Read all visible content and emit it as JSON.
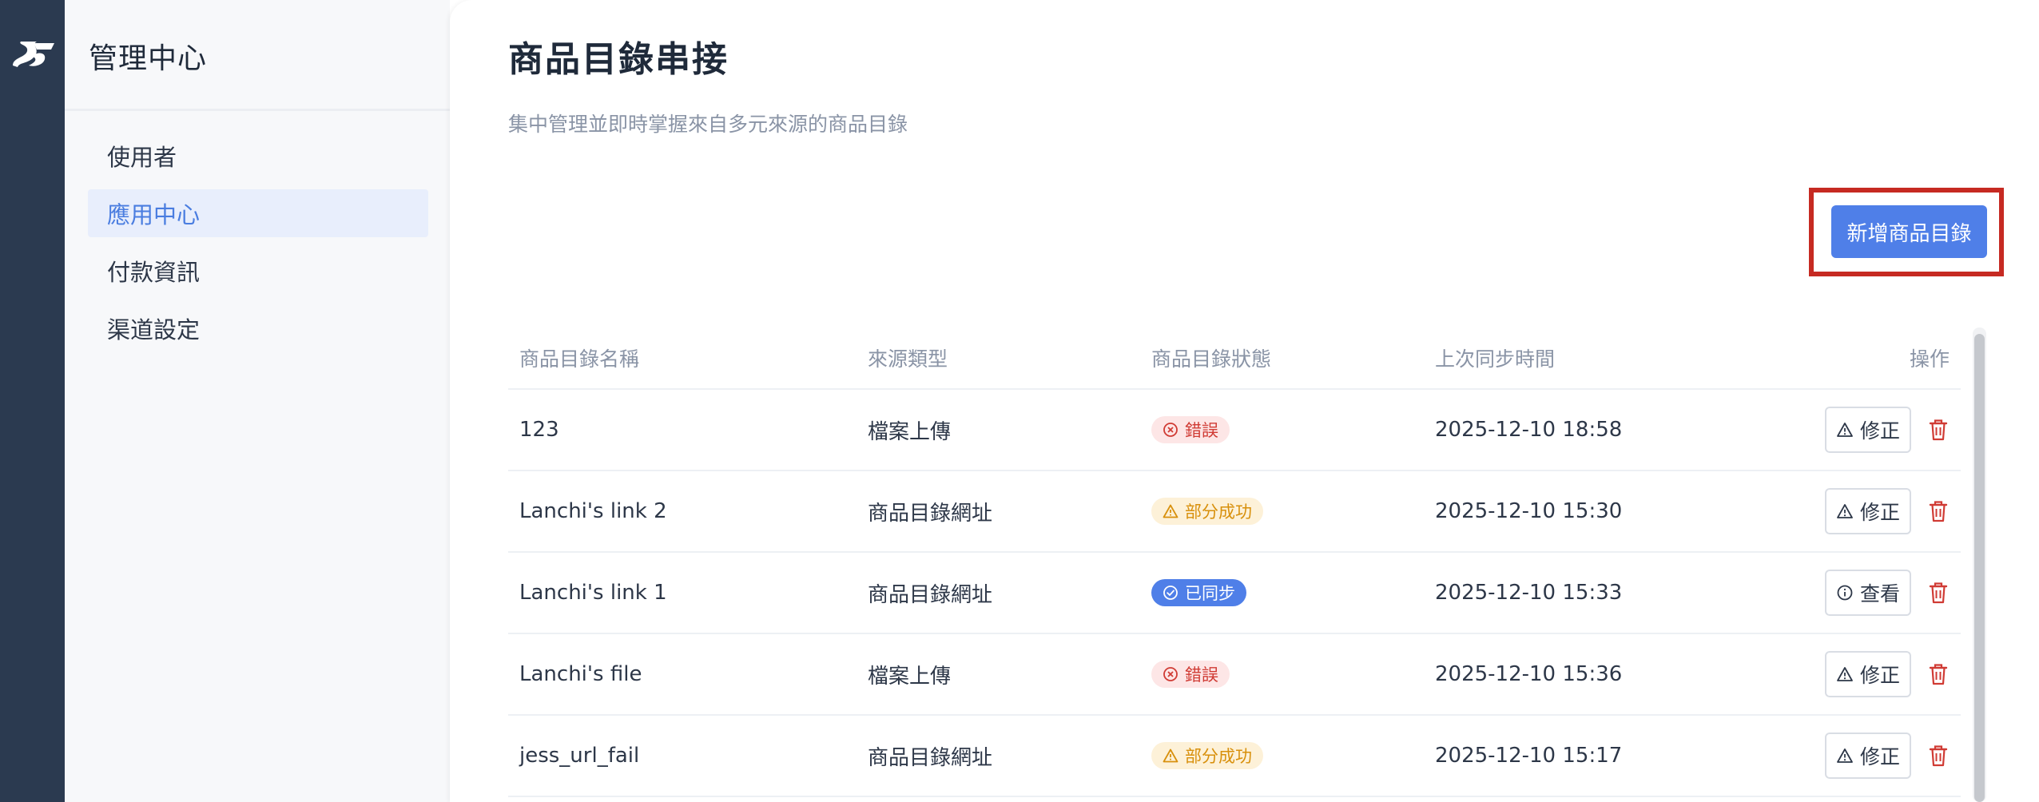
{
  "sidebar": {
    "title": "管理中心",
    "items": [
      {
        "label": "使用者",
        "active": false
      },
      {
        "label": "應用中心",
        "active": true
      },
      {
        "label": "付款資訊",
        "active": false
      },
      {
        "label": "渠道設定",
        "active": false
      }
    ]
  },
  "page": {
    "title": "商品目錄串接",
    "subtitle": "集中管理並即時掌握來自多元來源的商品目錄",
    "add_button": "新增商品目錄"
  },
  "table": {
    "headers": {
      "name": "商品目錄名稱",
      "source": "來源類型",
      "status": "商品目錄狀態",
      "time": "上次同步時間",
      "actions": "操作"
    },
    "rows": [
      {
        "name": "123",
        "source": "檔案上傳",
        "status": "錯誤",
        "status_type": "error",
        "time": "2025-12-10 18:58",
        "action": "修正",
        "action_icon": "warning-icon"
      },
      {
        "name": "Lanchi's link 2",
        "source": "商品目錄網址",
        "status": "部分成功",
        "status_type": "partial",
        "time": "2025-12-10 15:30",
        "action": "修正",
        "action_icon": "warning-icon"
      },
      {
        "name": "Lanchi's link 1",
        "source": "商品目錄網址",
        "status": "已同步",
        "status_type": "synced",
        "time": "2025-12-10 15:33",
        "action": "查看",
        "action_icon": "info-icon"
      },
      {
        "name": "Lanchi's file",
        "source": "檔案上傳",
        "status": "錯誤",
        "status_type": "error",
        "time": "2025-12-10 15:36",
        "action": "修正",
        "action_icon": "warning-icon"
      },
      {
        "name": "jess_url_fail",
        "source": "商品目錄網址",
        "status": "部分成功",
        "status_type": "partial",
        "time": "2025-12-10 15:17",
        "action": "修正",
        "action_icon": "warning-icon"
      }
    ]
  },
  "colors": {
    "rail": "#2b3a50",
    "accent": "#4f7fe8",
    "error": "#d03b34",
    "partial": "#d8900c",
    "highlight": "#c62a22"
  }
}
